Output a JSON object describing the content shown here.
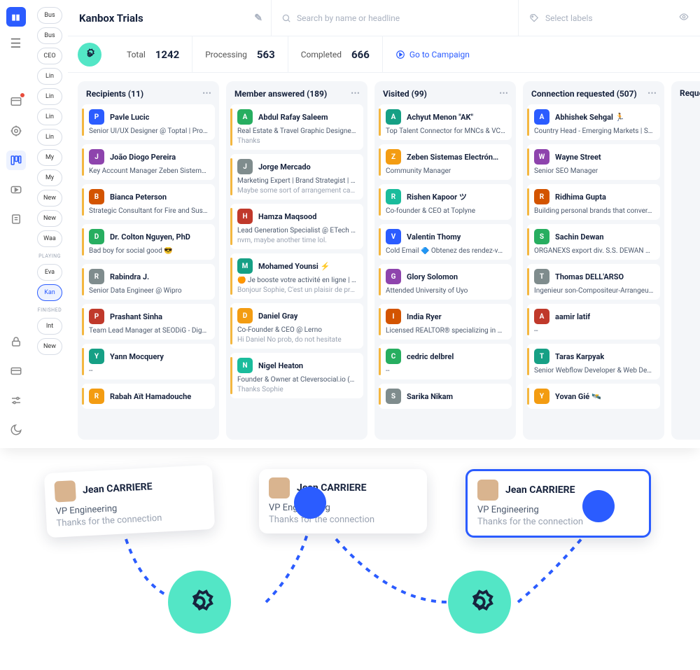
{
  "header": {
    "title": "Kanbox Trials",
    "search_placeholder": "Search by name or headline",
    "labels_placeholder": "Select labels"
  },
  "stats": {
    "total_label": "Total",
    "total_value": "1242",
    "processing_label": "Processing",
    "processing_value": "563",
    "completed_label": "Completed",
    "completed_value": "666",
    "campaign_link": "Go to Campaign"
  },
  "campaigns": {
    "items": [
      "Bus",
      "Bus",
      "CEO",
      "Lin",
      "Lin",
      "Lin",
      "Lin",
      "My",
      "My",
      "New",
      "New",
      "Waa"
    ],
    "playing_label": "PLAYING",
    "playing": [
      "Eva",
      "Kan"
    ],
    "finished_label": "FINISHED",
    "finished": [
      "Int",
      "New"
    ]
  },
  "columns": [
    {
      "title": "Recipients (11)",
      "cards": [
        {
          "name": "Pavle Lucic",
          "sub": "Senior UI/UX Designer @ Toptal | Prot…"
        },
        {
          "name": "João Diogo Pereira",
          "sub": "Key Account Manager Zeben Sistema…"
        },
        {
          "name": "Bianca Peterson",
          "sub": "Strategic Consultant for Fire and Sust…"
        },
        {
          "name": "Dr. Colton Nguyen, PhD",
          "sub": "Bad boy for social good 😎"
        },
        {
          "name": "Rabindra J.",
          "sub": "Senior Data Engineer @ Wipro"
        },
        {
          "name": "Prashant Sinha",
          "sub": "Team Lead Manager at SEODiG - Dig…"
        },
        {
          "name": "Yann Mocquery",
          "sub": "--"
        },
        {
          "name": "Rabah Aït Hamadouche",
          "sub": ""
        }
      ]
    },
    {
      "title": "Member answered (189)",
      "cards": [
        {
          "name": "Abdul Rafay Saleem",
          "sub": "Real Estate & Travel Graphic Designe…",
          "msg": "Thanks"
        },
        {
          "name": "Jorge Mercado",
          "sub": "Marketing Expert | Brand Strategist | …",
          "msg": "Maybe some sort of arrangement can be made? Or affiliate stuff?"
        },
        {
          "name": "Hamza Maqsood",
          "sub": "Lead Generation Specialist @ ETech …",
          "msg": "nvm, maybe another time lol."
        },
        {
          "name": "Mohamed Younsi ⚡",
          "sub": "🟠 Je booste votre activité en ligne | N…",
          "msg": "Bonjour Sophie, C'est un plaisir de prendre contact avec vous. :)"
        },
        {
          "name": "Daniel Gray",
          "sub": "Co-Founder & CEO @ Lerno",
          "msg": "Hi Daniel No prob, do not hesitate"
        },
        {
          "name": "Nigel Heaton",
          "sub": "Founder & Owner at Cleversocial.io (…",
          "msg": "Thanks Sophie"
        }
      ]
    },
    {
      "title": "Visited (99)",
      "cards": [
        {
          "name": "Achyut Menon \"AK\"",
          "sub": "Top Talent Connector for MNCs & VC…"
        },
        {
          "name": "Zeben Sistemas Electrón…",
          "sub": "Community Manager"
        },
        {
          "name": "Rishen Kapoor ツ",
          "sub": "Co-founder & CEO at Toplyne"
        },
        {
          "name": "Valentin Thomy",
          "sub": "Cold Email 🔷 Obtenez des rendez-vou…"
        },
        {
          "name": "Glory Solomon",
          "sub": "Attended University of Uyo"
        },
        {
          "name": "India Ryer",
          "sub": "Licensed REALTOR® specializing in S…"
        },
        {
          "name": "cedric delbrel",
          "sub": "--"
        },
        {
          "name": "Sarika Nikam",
          "sub": ""
        }
      ]
    },
    {
      "title": "Connection requested (507)",
      "cards": [
        {
          "name": "Abhishek Sehgal 🏃",
          "sub": "Country Head - Emerging Markets | S…"
        },
        {
          "name": "Wayne Street",
          "sub": "Senior SEO Manager"
        },
        {
          "name": "Ridhima Gupta",
          "sub": "Building personal brands that conver…"
        },
        {
          "name": "Sachin Dewan",
          "sub": "ORGANEXS export div. S.S. DEWAN …"
        },
        {
          "name": "Thomas DELL'ARSO",
          "sub": "Ingenieur son-Compositeur-Arrangeu…"
        },
        {
          "name": "aamir latif",
          "sub": "--"
        },
        {
          "name": "Taras Karpyak",
          "sub": "Senior Webflow Developer & Web De…"
        },
        {
          "name": "Yovan Gié 🛰️",
          "sub": ""
        }
      ]
    },
    {
      "title": "Request",
      "cards": []
    }
  ],
  "promo": {
    "name": "Jean CARRIERE",
    "title": "VP Engineering",
    "msg": "Thanks for the connection"
  }
}
